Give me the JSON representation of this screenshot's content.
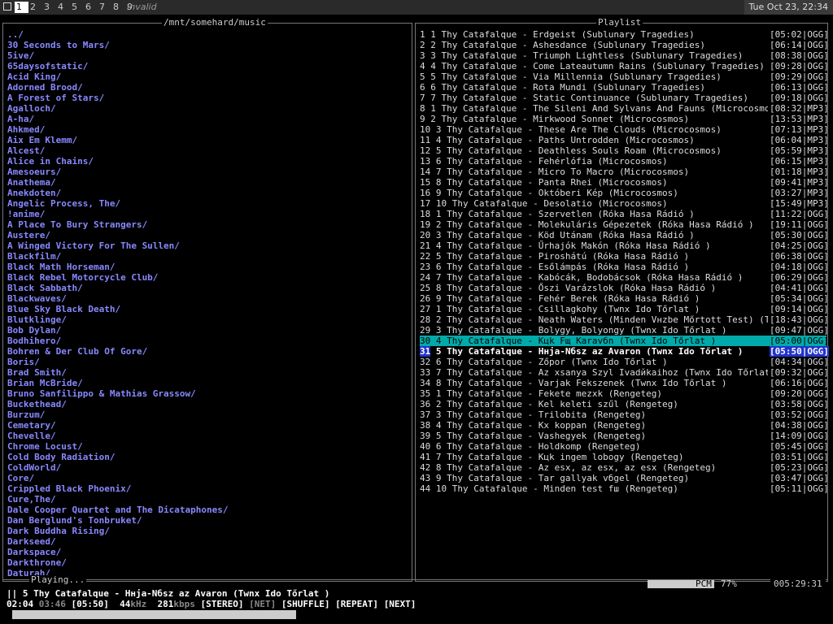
{
  "topbar": {
    "tags": [
      "1",
      "2",
      "3",
      "4",
      "5",
      "6",
      "7",
      "8",
      "9"
    ],
    "active_tag": 0,
    "client_title": "Invalid",
    "clock": "Tue Oct 23, 22:34"
  },
  "browser": {
    "title": "/mnt/somehard/music",
    "items": [
      "../",
      "30 Seconds to Mars/",
      "5ive/",
      "65daysofstatic/",
      "Acid King/",
      "Adorned Brood/",
      "A Forest of Stars/",
      "Agalloch/",
      "A-ha/",
      "Ahkmed/",
      "Aix Em Klemm/",
      "Alcest/",
      "Alice in Chains/",
      "Amesoeurs/",
      "Anathema/",
      "Anekdoten/",
      "Angelic Process, The/",
      "!anime/",
      "A Place To Bury Strangers/",
      "Austere/",
      "A Winged Victory For The Sullen/",
      "Blackfilm/",
      "Black Math Horseman/",
      "Black Rebel Motorcycle Club/",
      "Black Sabbath/",
      "Blackwaves/",
      "Blue Sky Black Death/",
      "Blutklinge/",
      "Bob Dylan/",
      "Bodhihero/",
      "Bohren & Der Club Of Gore/",
      "Boris/",
      "Brad Smith/",
      "Brian McBride/",
      "Bruno Sanfilippo & Mathias Grassow/",
      "Buckethead/",
      "Burzum/",
      "Cemetary/",
      "Chevelle/",
      "Chrome Locust/",
      "Cold Body Radiation/",
      "ColdWorld/",
      "Core/",
      "Crippled Black Phoenix/",
      "Cure,The/",
      "Dale Cooper Quartet and The Dicataphones/",
      "Dan Berglund's Tonbruket/",
      "Dark Buddha Rising/",
      "Darkseed/",
      "Darkspace/",
      "Darkthrone/",
      "Daturah/"
    ]
  },
  "playlist": {
    "title": "Playlist",
    "selected_index": 29,
    "current_index": 30,
    "rows": [
      {
        "n": "1",
        "text": "1 Thy Catafalque - Erdgeist (Sublunary Tragedies)",
        "dur": "[05:02|OGG]"
      },
      {
        "n": "2",
        "text": "2 Thy Catafalque - Ashesdance (Sublunary Tragedies)",
        "dur": "[06:14|OGG]"
      },
      {
        "n": "3",
        "text": "3 Thy Catafalque - Triumph Lightless (Sublunary Tragedies)",
        "dur": "[08:38|OGG]"
      },
      {
        "n": "4",
        "text": "4 Thy Catafalque - Come Lateautumn Rains (Sublunary Tragedies)",
        "dur": "[09:28|OGG]"
      },
      {
        "n": "5",
        "text": "5 Thy Catafalque - Via Millennia (Sublunary Tragedies)",
        "dur": "[09:29|OGG]"
      },
      {
        "n": "6",
        "text": "6 Thy Catafalque - Rota Mundi (Sublunary Tragedies)",
        "dur": "[06:13|OGG]"
      },
      {
        "n": "7",
        "text": "7 Thy Catafalque - Static Continuance (Sublunary Tragedies)",
        "dur": "[09:18|OGG]"
      },
      {
        "n": "8",
        "text": "1 Thy Catafalque - The Sileni And Sylvans And Fauns (Microcosmos)",
        "dur": "[08:32|MP3]"
      },
      {
        "n": "9",
        "text": "2 Thy Catafalque - Mirkwood Sonnet (Microcosmos)",
        "dur": "[13:53|MP3]"
      },
      {
        "n": "10",
        "text": "3 Thy Catafalque - These Are The Clouds (Microcosmos)",
        "dur": "[07:13|MP3]"
      },
      {
        "n": "11",
        "text": "4 Thy Catafalque - Paths Untrodden (Microcosmos)",
        "dur": "[06:04|MP3]"
      },
      {
        "n": "12",
        "text": "5 Thy Catafalque - Deathless Souls Roam (Microcosmos)",
        "dur": "[05:59|MP3]"
      },
      {
        "n": "13",
        "text": "6 Thy Catafalque - Fehérlófia (Microcosmos)",
        "dur": "[06:15|MP3]"
      },
      {
        "n": "14",
        "text": "7 Thy Catafalque - Micro To Macro (Microcosmos)",
        "dur": "[01:18|MP3]"
      },
      {
        "n": "15",
        "text": "8 Thy Catafalque - Panta Rhei (Microcosmos)",
        "dur": "[09:41|MP3]"
      },
      {
        "n": "16",
        "text": "9 Thy Catafalque - Októberi Kép (Microcosmos)",
        "dur": "[03:27|MP3]"
      },
      {
        "n": "17",
        "text": "10 Thy Catafalque - Desolatio (Microcosmos)",
        "dur": "[15:49|MP3]"
      },
      {
        "n": "18",
        "text": "1 Thy Catafalque - Szervetlen (Róka Hasa Rádió )",
        "dur": "[11:22|OGG]"
      },
      {
        "n": "19",
        "text": "2 Thy Catafalque - Molekuláris Gépezetek (Róka Hasa Rádió )",
        "dur": "[19:11|OGG]"
      },
      {
        "n": "20",
        "text": "3 Thy Catafalque - Köd Utánam (Róka Hasa Rádió )",
        "dur": "[05:30|OGG]"
      },
      {
        "n": "21",
        "text": "4 Thy Catafalque - Űrhajók Makón (Róka Hasa Rádió )",
        "dur": "[04:25|OGG]"
      },
      {
        "n": "22",
        "text": "5 Thy Catafalque - Piroshátú (Róka Hasa Rádió )",
        "dur": "[06:38|OGG]"
      },
      {
        "n": "23",
        "text": "6 Thy Catafalque - Esőlámpás (Róka Hasa Rádió )",
        "dur": "[04:18|OGG]"
      },
      {
        "n": "24",
        "text": "7 Thy Catafalque - Kabócák, Bodobácsok (Róka Hasa Rádió )",
        "dur": "[06:29|OGG]"
      },
      {
        "n": "25",
        "text": "8 Thy Catafalque - Őszi Varázslok (Róka Hasa Rádió )",
        "dur": "[04:41|OGG]"
      },
      {
        "n": "26",
        "text": "9 Thy Catafalque - Fehér Berek (Róka Hasa Rádió )",
        "dur": "[05:34|OGG]"
      },
      {
        "n": "27",
        "text": "1 Thy Catafalque - Csillagkohy (Twnx Ido Tőrlat )",
        "dur": "[09:14|OGG]"
      },
      {
        "n": "28",
        "text": "2 Thy Catafalque - Neath Waters (Minden Vнzbe Mőrtott Test) (Twnx Ido",
        "dur": "[18:43|OGG]"
      },
      {
        "n": "29",
        "text": "3 Thy Catafalque - Bolygу, Bolyongу (Twnx Ido Tőrlat )",
        "dur": "[09:47|OGG]"
      },
      {
        "n": "30",
        "text": "4 Thy Catafalque - Kцk Fщ Karavбn (Twnx Ido Tőrlat )",
        "dur": "[05:00|OGG]"
      },
      {
        "n": "31",
        "text": "5 Thy Catafalque - Hнja-Nбsz az Avaron (Twnx Ido Tőrlat )",
        "dur": "[05:50|OGG]"
      },
      {
        "n": "32",
        "text": "6 Thy Catafalque - Zőpor (Twnx Ido Tőrlat )",
        "dur": "[04:34|OGG]"
      },
      {
        "n": "33",
        "text": "7 Thy Catafalque - Az xsanya Szyl Ivadйkaihoz (Twnx Ido Tőrlat )",
        "dur": "[09:32|OGG]"
      },
      {
        "n": "34",
        "text": "8 Thy Catafalque - Varjak Fekszenek (Twnx Ido Tőrlat )",
        "dur": "[06:16|OGG]"
      },
      {
        "n": "35",
        "text": "1 Thy Catafalque - Fekete mezхk (Rengeteg)",
        "dur": "[09:20|OGG]"
      },
      {
        "n": "36",
        "text": "2 Thy Catafalque - Kel keleti szűl (Rengeteg)",
        "dur": "[03:58|OGG]"
      },
      {
        "n": "37",
        "text": "3 Thy Catafalque - Trilobita (Rengeteg)",
        "dur": "[03:52|OGG]"
      },
      {
        "n": "38",
        "text": "4 Thy Catafalque - Kх koppan (Rengeteg)",
        "dur": "[04:38|OGG]"
      },
      {
        "n": "39",
        "text": "5 Thy Catafalque - Vashegyek (Rengeteg)",
        "dur": "[14:09|OGG]"
      },
      {
        "n": "40",
        "text": "6 Thy Catafalque - Holdkomp (Rengeteg)",
        "dur": "[05:45|OGG]"
      },
      {
        "n": "41",
        "text": "7 Thy Catafalque - Kцk ingem lobogy (Rengeteg)",
        "dur": "[03:51|OGG]"
      },
      {
        "n": "42",
        "text": "8 Thy Catafalque - Az esx, az esx, az esx (Rengeteg)",
        "dur": "[05:23|OGG]"
      },
      {
        "n": "43",
        "text": "9 Thy Catafalque - Tar gallyak vбgel (Rengeteg)",
        "dur": "[03:47|OGG]"
      },
      {
        "n": "44",
        "text": "10 Thy Catafalque - Minden test fш (Rengeteg)",
        "dur": "[05:11|OGG]"
      }
    ]
  },
  "status": {
    "title": "Playing...",
    "mixer_label": "PCM",
    "volume": "77%",
    "total_time": "005:29:31",
    "now_playing": "|| 5 Thy Catafalque - Hнja-Nбsz az Avaron (Twnx Ido Tőrlat )",
    "elapsed": "02:04",
    "remaining": "03:46",
    "duration": "[05:50]",
    "rate_value": "44",
    "rate_unit": "kHz",
    "bitrate_value": "281",
    "bitrate_unit": "kbps",
    "flag_stereo": "[STEREO]",
    "flag_net": "[NET]",
    "flag_shuffle": "[SHUFFLE]",
    "flag_repeat": "[REPEAT]",
    "flag_next": "[NEXT]",
    "progress": 0.354
  }
}
